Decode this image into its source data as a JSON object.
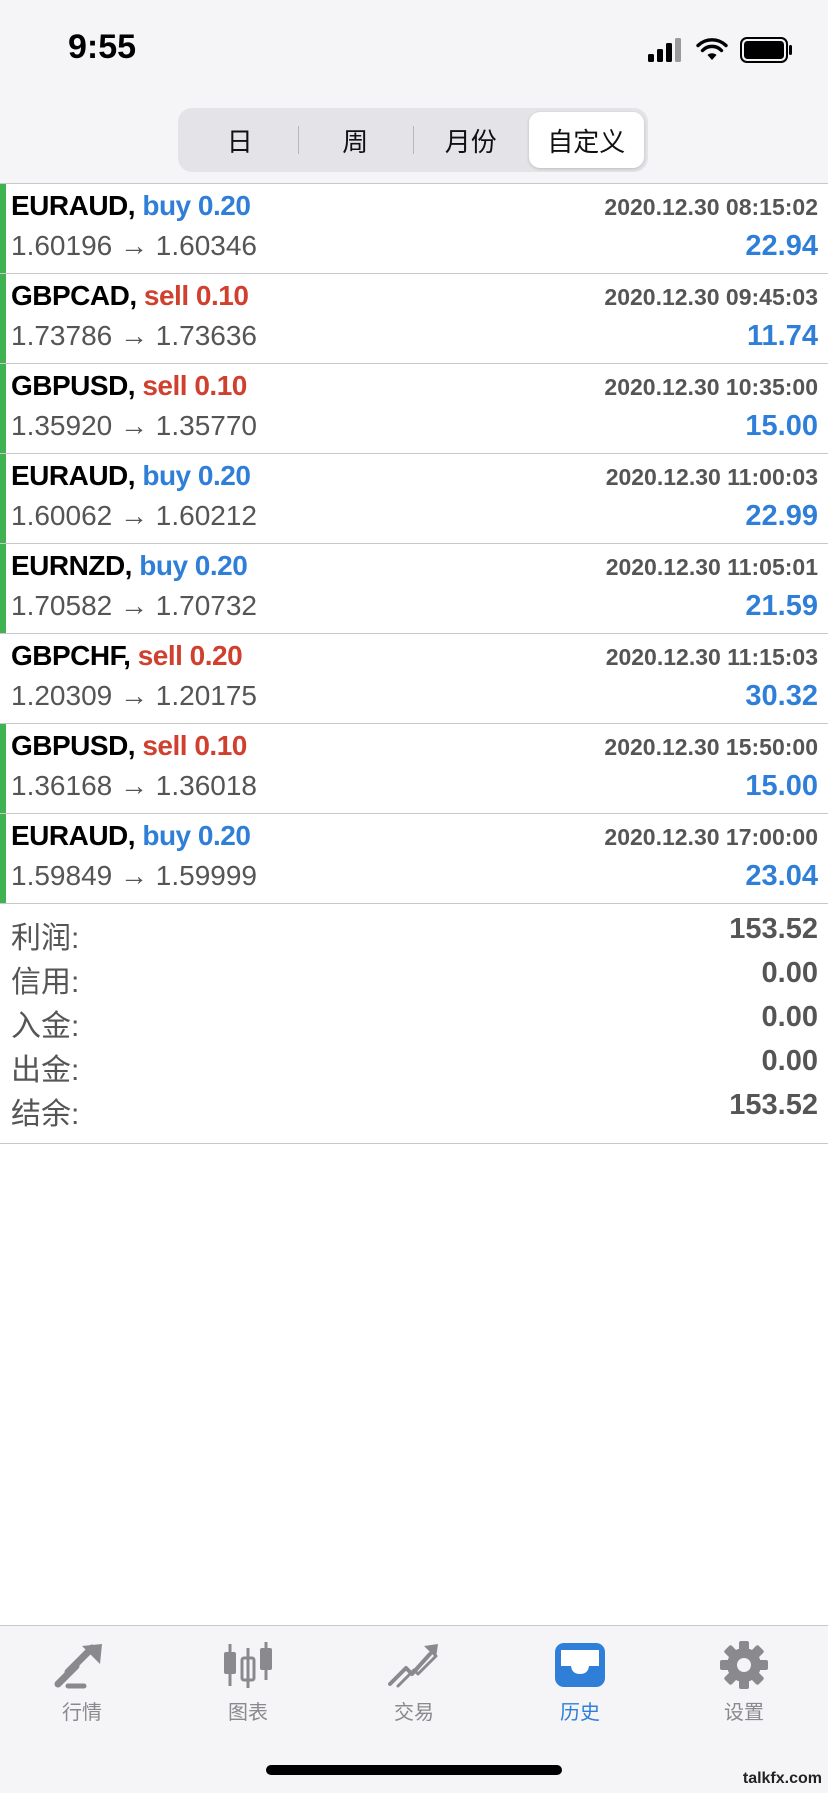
{
  "status": {
    "time": "9:55"
  },
  "segments": [
    {
      "label": "日",
      "active": false
    },
    {
      "label": "周",
      "active": false
    },
    {
      "label": "月份",
      "active": false
    },
    {
      "label": "自定义",
      "active": true
    }
  ],
  "trades": [
    {
      "symbol": "EURAUD,",
      "direction": "buy",
      "volume": "buy 0.20",
      "time": "2020.12.30 08:15:02",
      "prices": "1.60196 → 1.60346",
      "profit": "22.94",
      "bar": true
    },
    {
      "symbol": "GBPCAD,",
      "direction": "sell",
      "volume": "sell 0.10",
      "time": "2020.12.30 09:45:03",
      "prices": "1.73786 → 1.73636",
      "profit": "11.74",
      "bar": true
    },
    {
      "symbol": "GBPUSD,",
      "direction": "sell",
      "volume": "sell 0.10",
      "time": "2020.12.30 10:35:00",
      "prices": "1.35920 → 1.35770",
      "profit": "15.00",
      "bar": true
    },
    {
      "symbol": "EURAUD,",
      "direction": "buy",
      "volume": "buy 0.20",
      "time": "2020.12.30 11:00:03",
      "prices": "1.60062 → 1.60212",
      "profit": "22.99",
      "bar": true
    },
    {
      "symbol": "EURNZD,",
      "direction": "buy",
      "volume": "buy 0.20",
      "time": "2020.12.30 11:05:01",
      "prices": "1.70582 → 1.70732",
      "profit": "21.59",
      "bar": true
    },
    {
      "symbol": "GBPCHF,",
      "direction": "sell",
      "volume": "sell 0.20",
      "time": "2020.12.30 11:15:03",
      "prices": "1.20309 → 1.20175",
      "profit": "30.32",
      "bar": false
    },
    {
      "symbol": "GBPUSD,",
      "direction": "sell",
      "volume": "sell 0.10",
      "time": "2020.12.30 15:50:00",
      "prices": "1.36168 → 1.36018",
      "profit": "15.00",
      "bar": true
    },
    {
      "symbol": "EURAUD,",
      "direction": "buy",
      "volume": "buy 0.20",
      "time": "2020.12.30 17:00:00",
      "prices": "1.59849 → 1.59999",
      "profit": "23.04",
      "bar": true
    }
  ],
  "summary": [
    {
      "label": "利润:",
      "value": "153.52"
    },
    {
      "label": "信用:",
      "value": "0.00"
    },
    {
      "label": "入金:",
      "value": "0.00"
    },
    {
      "label": "出金:",
      "value": "0.00"
    },
    {
      "label": "结余:",
      "value": "153.52"
    }
  ],
  "tabs": [
    {
      "label": "行情",
      "icon": "quotes-icon",
      "active": false
    },
    {
      "label": "图表",
      "icon": "chart-icon",
      "active": false
    },
    {
      "label": "交易",
      "icon": "trade-icon",
      "active": false
    },
    {
      "label": "历史",
      "icon": "history-icon",
      "active": true
    },
    {
      "label": "设置",
      "icon": "settings-icon",
      "active": false
    }
  ],
  "watermark": "talkfx.com",
  "colors": {
    "buy": "#2f7fd8",
    "sell": "#d0402f",
    "bar": "#3fb34f",
    "active_tab": "#2f7fd8"
  }
}
